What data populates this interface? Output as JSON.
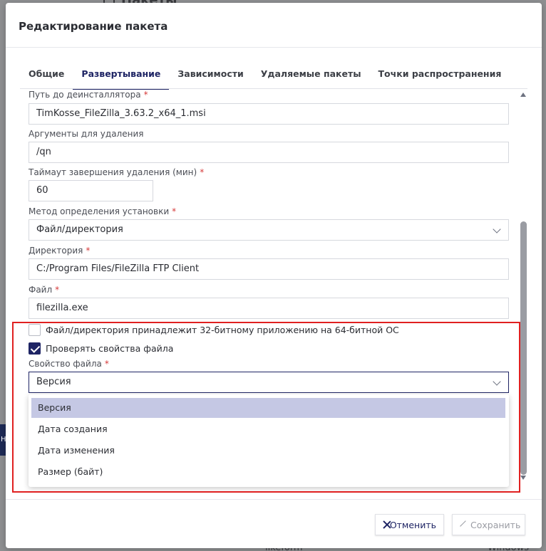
{
  "background": {
    "page_title": "Пакеты",
    "left_strip_letter": "Н",
    "row_name": "likeform",
    "row_platform": "Windows"
  },
  "modal": {
    "title": "Редактирование пакета",
    "tabs": [
      {
        "label": "Общие",
        "active": false
      },
      {
        "label": "Развертывание",
        "active": true
      },
      {
        "label": "Зависимости",
        "active": false
      },
      {
        "label": "Удаляемые пакеты",
        "active": false
      },
      {
        "label": "Точки распространения",
        "active": false
      }
    ],
    "fields": {
      "uninstaller_path": {
        "label": "Путь до деинсталлятора",
        "required": "*",
        "value": "TimKosse_FileZilla_3.63.2_x64_1.msi"
      },
      "uninstall_args": {
        "label": "Аргументы для удаления",
        "value": "/qn"
      },
      "uninstall_timeout": {
        "label": "Таймаут завершения удаления (мин)",
        "required": "*",
        "value": "60"
      },
      "detection_method": {
        "label": "Метод определения установки",
        "required": "*",
        "value": "Файл/директория"
      },
      "directory": {
        "label": "Директория",
        "required": "*",
        "value": "C:/Program Files/FileZilla FTP Client"
      },
      "file": {
        "label": "Файл",
        "required": "*",
        "value": "filezilla.exe"
      },
      "is_32bit": {
        "label": "Файл/директория принадлежит 32-битному приложению на 64-битной ОС",
        "checked": false
      },
      "check_file_props": {
        "label": "Проверять свойства файла",
        "checked": true
      },
      "file_property": {
        "label": "Свойство файла",
        "required": "*",
        "value": "Версия"
      }
    },
    "file_property_options": [
      {
        "label": "Версия",
        "selected": true
      },
      {
        "label": "Дата создания",
        "selected": false
      },
      {
        "label": "Дата изменения",
        "selected": false
      },
      {
        "label": "Размер (байт)",
        "selected": false
      }
    ],
    "buttons": {
      "cancel": "Отменить",
      "save": "Сохранить"
    },
    "colors": {
      "accent": "#1e2464",
      "required": "#d63a3a",
      "selected_option": "#c5c8e4",
      "highlight_box": "#e02020"
    }
  }
}
